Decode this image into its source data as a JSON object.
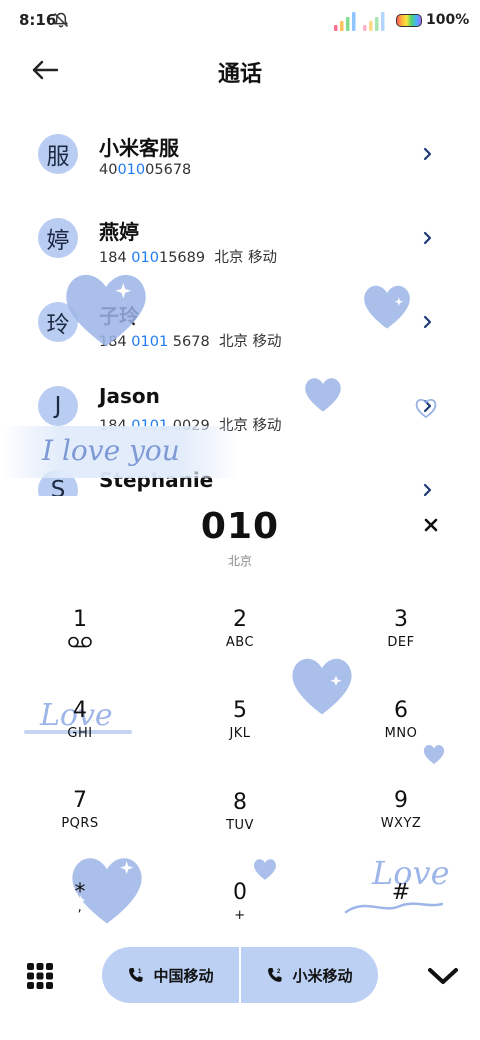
{
  "status_bar": {
    "time": "8:16",
    "battery": "100%"
  },
  "header": {
    "title": "通话"
  },
  "contacts": [
    {
      "avatar": "服",
      "name": "小米客服",
      "num_pre": "40",
      "num_hl": "010",
      "num_post": "05678",
      "location": ""
    },
    {
      "avatar": "婷",
      "name": "燕婷",
      "num_pre": "184 ",
      "num_hl": "010",
      "num_post": "15689",
      "location": "北京 移动"
    },
    {
      "avatar": "玲",
      "name": "子玲",
      "num_pre": "184 ",
      "num_hl": "0101",
      "num_post": " 5678",
      "location": "北京 移动"
    },
    {
      "avatar": "J",
      "name": "Jason",
      "num_pre": "184 ",
      "num_hl": "0101",
      "num_post": " 0029",
      "location": "北京 移动"
    },
    {
      "avatar": "S",
      "name": "Stephanie",
      "num_pre": "",
      "num_hl": "",
      "num_post": "",
      "location": ""
    }
  ],
  "decorations": {
    "love_you": "I love you",
    "love_1": "Love",
    "love_2": "Love"
  },
  "dial": {
    "number": "010",
    "location": "北京"
  },
  "keypad": [
    {
      "digit": "1",
      "letters": ""
    },
    {
      "digit": "2",
      "letters": "ABC"
    },
    {
      "digit": "3",
      "letters": "DEF"
    },
    {
      "digit": "4",
      "letters": "GHI"
    },
    {
      "digit": "5",
      "letters": "JKL"
    },
    {
      "digit": "6",
      "letters": "MNO"
    },
    {
      "digit": "7",
      "letters": "PQRS"
    },
    {
      "digit": "8",
      "letters": "TUV"
    },
    {
      "digit": "9",
      "letters": "WXYZ"
    },
    {
      "digit": "*",
      "letters": ","
    },
    {
      "digit": "0",
      "letters": "+"
    },
    {
      "digit": "#",
      "letters": ""
    }
  ],
  "call_buttons": {
    "sim1": "中国移动",
    "sim2": "小米移动"
  },
  "colors": {
    "accent": "#1f7cf2",
    "avatar_bg": "#b9cdf2",
    "call_bg": "#bcd0f4",
    "heart": "#9db5e8"
  }
}
